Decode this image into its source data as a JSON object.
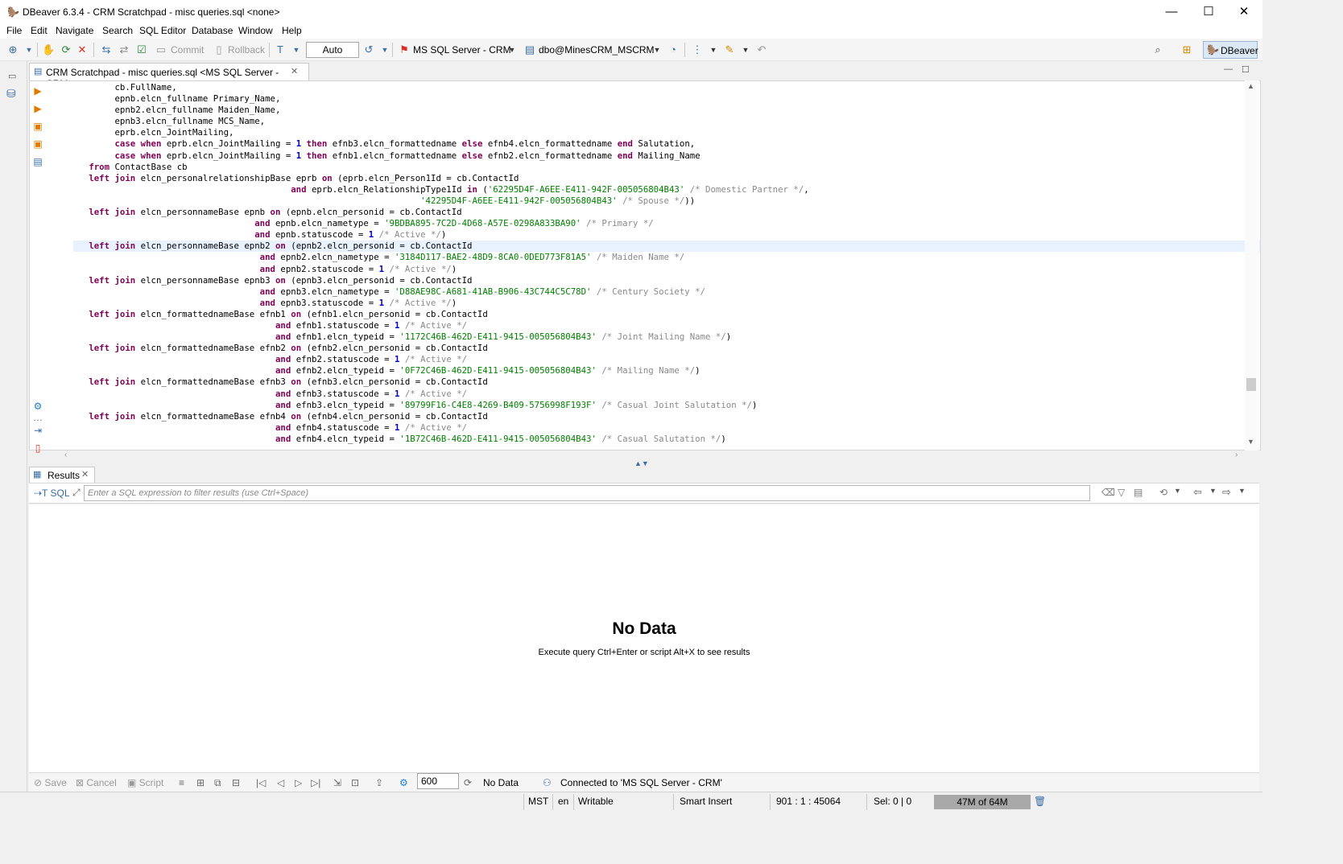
{
  "window": {
    "title": "DBeaver 6.3.4 - CRM Scratchpad - misc queries.sql <none>",
    "minimize": "—",
    "maximize": "☐",
    "close": "✕"
  },
  "menu": [
    "File",
    "Edit",
    "Navigate",
    "Search",
    "SQL Editor",
    "Database",
    "Window",
    "Help"
  ],
  "toolbar": {
    "commit_label": "Commit",
    "rollback_label": "Rollback",
    "transaction_mode": "Auto",
    "datasource": "MS SQL Server - CRM",
    "schema": "dbo@MinesCRM_MSCRM",
    "perspective": "DBeaver"
  },
  "editor": {
    "tab_label": "CRM Scratchpad - misc queries.sql <MS SQL Server - CRM>",
    "lines": [
      [
        [
          "",
          "        cb.FullName,"
        ]
      ],
      [
        [
          "",
          "        epnb.elcn_fullname Primary_Name,"
        ]
      ],
      [
        [
          "",
          "        epnb2.elcn_fullname Maiden_Name,"
        ]
      ],
      [
        [
          "",
          "        epnb3.elcn_fullname MCS_Name,"
        ]
      ],
      [
        [
          "",
          "        eprb.elcn_JointMailing,"
        ]
      ],
      [
        [
          "",
          "        "
        ],
        [
          "kw",
          "case"
        ],
        [
          "",
          " "
        ],
        [
          "kw",
          "when"
        ],
        [
          "",
          " eprb.elcn_JointMailing = "
        ],
        [
          "num",
          "1"
        ],
        [
          "",
          " "
        ],
        [
          "kw",
          "then"
        ],
        [
          "",
          " efnb3.elcn_formattedname "
        ],
        [
          "kw",
          "else"
        ],
        [
          "",
          " efnb4.elcn_formattedname "
        ],
        [
          "kw",
          "end"
        ],
        [
          "",
          " Salutation,"
        ]
      ],
      [
        [
          "",
          "        "
        ],
        [
          "kw",
          "case"
        ],
        [
          "",
          " "
        ],
        [
          "kw",
          "when"
        ],
        [
          "",
          " eprb.elcn_JointMailing = "
        ],
        [
          "num",
          "1"
        ],
        [
          "",
          " "
        ],
        [
          "kw",
          "then"
        ],
        [
          "",
          " efnb1.elcn_formattedname "
        ],
        [
          "kw",
          "else"
        ],
        [
          "",
          " efnb2.elcn_formattedname "
        ],
        [
          "kw",
          "end"
        ],
        [
          "",
          " Mailing_Name"
        ]
      ],
      [
        [
          "",
          "   "
        ],
        [
          "kw",
          "from"
        ],
        [
          "",
          " ContactBase cb"
        ]
      ],
      [
        [
          "",
          "   "
        ],
        [
          "kw",
          "left join"
        ],
        [
          "",
          " elcn_personalrelationshipBase eprb "
        ],
        [
          "kw",
          "on"
        ],
        [
          "",
          " (eprb.elcn_Person1Id = cb.ContactId"
        ]
      ],
      [
        [
          "",
          "                                          "
        ],
        [
          "kw",
          "and"
        ],
        [
          "",
          " eprb.elcn_RelationshipType1Id "
        ],
        [
          "kw",
          "in"
        ],
        [
          "",
          " ("
        ],
        [
          "str",
          "'62295D4F-A6EE-E411-942F-005056804B43'"
        ],
        [
          "",
          " "
        ],
        [
          "cm",
          "/* Domestic Partner */"
        ],
        [
          "",
          ","
        ]
      ],
      [
        [
          "",
          "                                                                   "
        ],
        [
          "str",
          "'42295D4F-A6EE-E411-942F-005056804B43'"
        ],
        [
          "",
          " "
        ],
        [
          "cm",
          "/* Spouse */"
        ],
        [
          "",
          "))"
        ]
      ],
      [
        [
          "",
          "   "
        ],
        [
          "kw",
          "left join"
        ],
        [
          "",
          " elcn_personnameBase epnb "
        ],
        [
          "kw",
          "on"
        ],
        [
          "",
          " (epnb.elcn_personid = cb.ContactId"
        ]
      ],
      [
        [
          "",
          "                                   "
        ],
        [
          "kw",
          "and"
        ],
        [
          "",
          " epnb.elcn_nametype = "
        ],
        [
          "str",
          "'9BDBA895-7C2D-4D68-A57E-0298A833BA90'"
        ],
        [
          "",
          " "
        ],
        [
          "cm",
          "/* Primary */"
        ]
      ],
      [
        [
          "",
          "                                   "
        ],
        [
          "kw",
          "and"
        ],
        [
          "",
          " epnb.statuscode = "
        ],
        [
          "num",
          "1"
        ],
        [
          "",
          " "
        ],
        [
          "cm",
          "/* Active */"
        ],
        [
          "",
          ")"
        ]
      ],
      [
        [
          "",
          "   "
        ],
        [
          "kw",
          "left join"
        ],
        [
          "",
          " elcn_personnameBase epnb2 "
        ],
        [
          "kw",
          "on"
        ],
        [
          "",
          " (epnb2.elcn_personid = cb.ContactId"
        ]
      ],
      [
        [
          "",
          "                                    "
        ],
        [
          "kw",
          "and"
        ],
        [
          "",
          " epnb2.elcn_nametype = "
        ],
        [
          "str",
          "'3184D117-BAE2-48D9-8CA0-0DED773F81A5'"
        ],
        [
          "",
          " "
        ],
        [
          "cm",
          "/* Maiden Name */"
        ]
      ],
      [
        [
          "",
          "                                    "
        ],
        [
          "kw",
          "and"
        ],
        [
          "",
          " epnb2.statuscode = "
        ],
        [
          "num",
          "1"
        ],
        [
          "",
          " "
        ],
        [
          "cm",
          "/* Active */"
        ],
        [
          "",
          ")"
        ]
      ],
      [
        [
          "",
          "   "
        ],
        [
          "kw",
          "left join"
        ],
        [
          "",
          " elcn_personnameBase epnb3 "
        ],
        [
          "kw",
          "on"
        ],
        [
          "",
          " (epnb3.elcn_personid = cb.ContactId"
        ]
      ],
      [
        [
          "",
          "                                    "
        ],
        [
          "kw",
          "and"
        ],
        [
          "",
          " epnb3.elcn_nametype = "
        ],
        [
          "str",
          "'D88AE98C-A681-41AB-B906-43C744C5C78D'"
        ],
        [
          "",
          " "
        ],
        [
          "cm",
          "/* Century Society */"
        ]
      ],
      [
        [
          "",
          "                                    "
        ],
        [
          "kw",
          "and"
        ],
        [
          "",
          " epnb3.statuscode = "
        ],
        [
          "num",
          "1"
        ],
        [
          "",
          " "
        ],
        [
          "cm",
          "/* Active */"
        ],
        [
          "",
          ")"
        ]
      ],
      [
        [
          "",
          "   "
        ],
        [
          "kw",
          "left join"
        ],
        [
          "",
          " elcn_formattednameBase efnb1 "
        ],
        [
          "kw",
          "on"
        ],
        [
          "",
          " (efnb1.elcn_personid = cb.ContactId"
        ]
      ],
      [
        [
          "",
          "                                       "
        ],
        [
          "kw",
          "and"
        ],
        [
          "",
          " efnb1.statuscode = "
        ],
        [
          "num",
          "1"
        ],
        [
          "",
          " "
        ],
        [
          "cm",
          "/* Active */"
        ]
      ],
      [
        [
          "",
          "                                       "
        ],
        [
          "kw",
          "and"
        ],
        [
          "",
          " efnb1.elcn_typeid = "
        ],
        [
          "str",
          "'1172C46B-462D-E411-9415-005056804B43'"
        ],
        [
          "",
          " "
        ],
        [
          "cm",
          "/* Joint Mailing Name */"
        ],
        [
          "",
          ")"
        ]
      ],
      [
        [
          "",
          "   "
        ],
        [
          "kw",
          "left join"
        ],
        [
          "",
          " elcn_formattednameBase efnb2 "
        ],
        [
          "kw",
          "on"
        ],
        [
          "",
          " (efnb2.elcn_personid = cb.ContactId"
        ]
      ],
      [
        [
          "",
          "                                       "
        ],
        [
          "kw",
          "and"
        ],
        [
          "",
          " efnb2.statuscode = "
        ],
        [
          "num",
          "1"
        ],
        [
          "",
          " "
        ],
        [
          "cm",
          "/* Active */"
        ]
      ],
      [
        [
          "",
          "                                       "
        ],
        [
          "kw",
          "and"
        ],
        [
          "",
          " efnb2.elcn_typeid = "
        ],
        [
          "str",
          "'0F72C46B-462D-E411-9415-005056804B43'"
        ],
        [
          "",
          " "
        ],
        [
          "cm",
          "/* Mailing Name */"
        ],
        [
          "",
          ")"
        ]
      ],
      [
        [
          "",
          "   "
        ],
        [
          "kw",
          "left join"
        ],
        [
          "",
          " elcn_formattednameBase efnb3 "
        ],
        [
          "kw",
          "on"
        ],
        [
          "",
          " (efnb3.elcn_personid = cb.ContactId"
        ]
      ],
      [
        [
          "",
          "                                       "
        ],
        [
          "kw",
          "and"
        ],
        [
          "",
          " efnb3.statuscode = "
        ],
        [
          "num",
          "1"
        ],
        [
          "",
          " "
        ],
        [
          "cm",
          "/* Active */"
        ]
      ],
      [
        [
          "",
          "                                       "
        ],
        [
          "kw",
          "and"
        ],
        [
          "",
          " efnb3.elcn_typeid = "
        ],
        [
          "str",
          "'89799F16-C4E8-4269-B409-5756998F193F'"
        ],
        [
          "",
          " "
        ],
        [
          "cm",
          "/* Casual Joint Salutation */"
        ],
        [
          "",
          ")"
        ]
      ],
      [
        [
          "",
          "   "
        ],
        [
          "kw",
          "left join"
        ],
        [
          "",
          " elcn_formattednameBase efnb4 "
        ],
        [
          "kw",
          "on"
        ],
        [
          "",
          " (efnb4.elcn_personid = cb.ContactId"
        ]
      ],
      [
        [
          "",
          "                                       "
        ],
        [
          "kw",
          "and"
        ],
        [
          "",
          " efnb4.statuscode = "
        ],
        [
          "num",
          "1"
        ],
        [
          "",
          " "
        ],
        [
          "cm",
          "/* Active */"
        ]
      ],
      [
        [
          "",
          "                                       "
        ],
        [
          "kw",
          "and"
        ],
        [
          "",
          " efnb4.elcn_typeid = "
        ],
        [
          "str",
          "'1B72C46B-462D-E411-9415-005056804B43'"
        ],
        [
          "",
          " "
        ],
        [
          "cm",
          "/* Casual Salutation */"
        ],
        [
          "",
          ")"
        ]
      ]
    ],
    "current_line_index": 14
  },
  "results": {
    "tab_label": "Results",
    "sql_label": "SQL",
    "filter_placeholder": "Enter a SQL expression to filter results (use Ctrl+Space)",
    "no_data_title": "No Data",
    "no_data_hint": "Execute query Ctrl+Enter or script Alt+X to see results",
    "save_label": "Save",
    "cancel_label": "Cancel",
    "script_label": "Script",
    "fetch_size": "600",
    "row_status": "No Data",
    "connection_status": "Connected to 'MS SQL Server - CRM'"
  },
  "statusbar": {
    "timezone": "MST",
    "locale": "en",
    "mode": "Writable",
    "insert_mode": "Smart Insert",
    "cursor_pos": "901 : 1 : 45064",
    "selection": "Sel: 0 | 0",
    "heap": "47M of 64M"
  },
  "colors": {
    "keyword": "#7f0055",
    "string": "#008000",
    "comment": "#8a8a8a",
    "number": "#0000c0",
    "current_line": "#e8f2fe"
  }
}
